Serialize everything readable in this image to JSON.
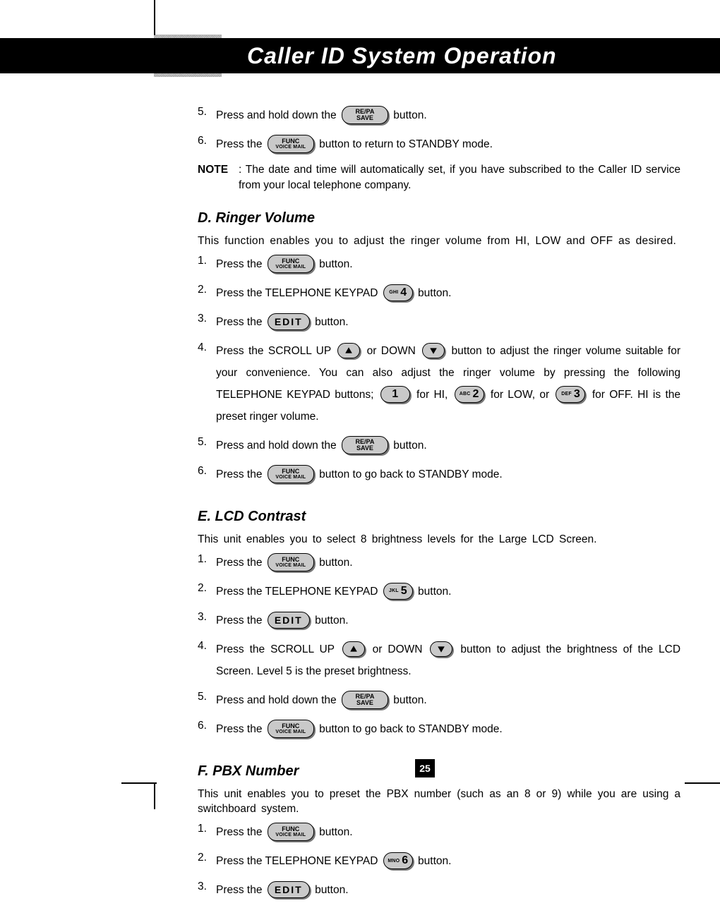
{
  "header": {
    "title": "Caller ID System Operation"
  },
  "keys": {
    "repa_top": "RE/PA",
    "repa_bot": "SAVE",
    "func_top": "FUNC",
    "func_bot": "VOICE  MAIL",
    "edit": "EDIT",
    "k1_num": "1",
    "k2_sub": "ABC",
    "k2_num": "2",
    "k3_sub": "DEF",
    "k3_num": "3",
    "k4_sub": "GHI",
    "k4_num": "4",
    "k5_sub": "JKL",
    "k5_num": "5",
    "k6_sub": "MNO",
    "k6_num": "6"
  },
  "secA": {
    "s5_a": "Press and hold down the ",
    "s5_b": " button.",
    "s6_a": "Press the ",
    "s6_b": " button to return to STANDBY mode.",
    "note_label": "NOTE",
    "note_text": ": The date and time will automatically set, if you have subscribed to the Caller ID service from your local telephone company."
  },
  "secD": {
    "head": "D. Ringer Volume",
    "intro": "This function enables you to adjust the ringer volume from HI, LOW and OFF as desired.",
    "s1_a": "Press the ",
    "s1_b": " button.",
    "s2_a": "Press the TELEPHONE KEYPAD ",
    "s2_b": " button.",
    "s3_a": "Press the ",
    "s3_b": " button.",
    "s4_a": "Press the SCROLL UP ",
    "s4_b": " or DOWN ",
    "s4_c": " button to adjust the ringer volume suitable for your convenience. You can also adjust the ringer volume by pressing the following TELEPHONE KEYPAD buttons; ",
    "s4_d": " for HI, ",
    "s4_e": " for LOW, or ",
    "s4_f": " for OFF. HI is the preset ringer volume.",
    "s5_a": "Press and hold down the ",
    "s5_b": " button.",
    "s6_a": "Press the ",
    "s6_b": " button to go back to STANDBY mode."
  },
  "secE": {
    "head": "E. LCD Contrast",
    "intro": "This unit enables you to select 8 brightness levels for the Large LCD Screen.",
    "s1_a": "Press the ",
    "s1_b": " button.",
    "s2_a": "Press the TELEPHONE KEYPAD ",
    "s2_b": " button.",
    "s3_a": "Press the ",
    "s3_b": " button.",
    "s4_a": "Press the SCROLL UP ",
    "s4_b": " or DOWN ",
    "s4_c": " button to adjust the brightness of the LCD Screen. Level 5 is the preset brightness.",
    "s5_a": "Press and hold down the ",
    "s5_b": " button.",
    "s6_a": "Press the ",
    "s6_b": " button to go back to STANDBY mode."
  },
  "secF": {
    "head": "F. PBX Number",
    "intro": "This unit enables you to preset the PBX number (such as an 8 or 9) while you are using a switchboard system.",
    "s1_a": "Press the ",
    "s1_b": " button.",
    "s2_a": "Press the TELEPHONE KEYPAD ",
    "s2_b": " button.",
    "s3_a": "Press the ",
    "s3_b": " button."
  },
  "page_number": "25"
}
